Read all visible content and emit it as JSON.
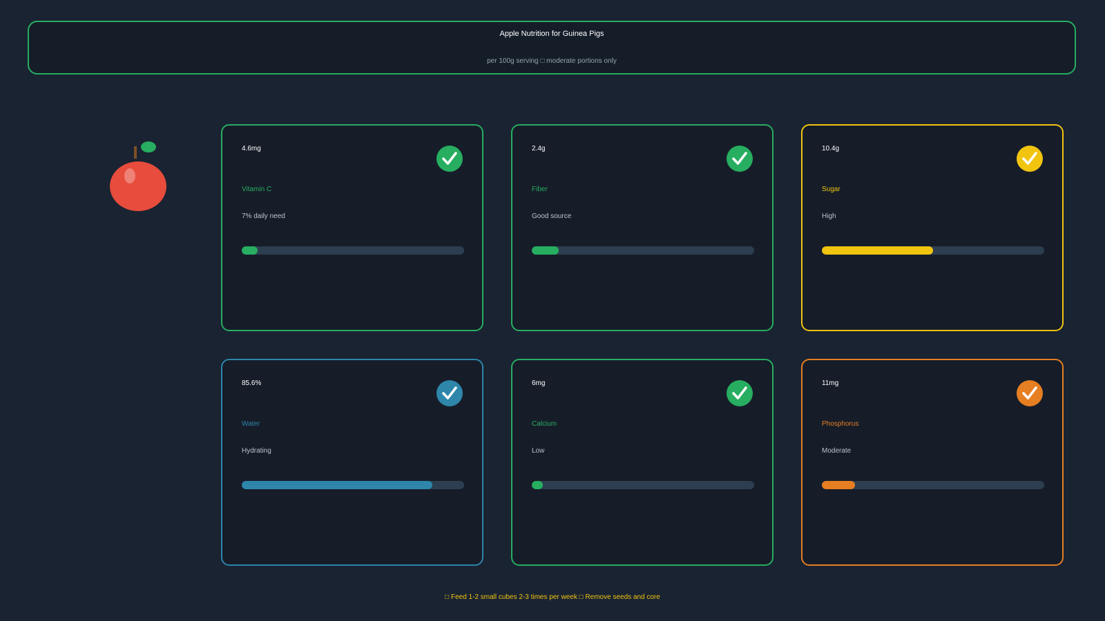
{
  "header": {
    "title": "Apple Nutrition for Guinea Pigs",
    "subtitle": "per 100g serving □ moderate portions only"
  },
  "illustration": {
    "icon": "apple-icon"
  },
  "colors": {
    "background": "#1a2332",
    "good": "#27ae60",
    "caution": "#f1c40f",
    "info": "#2e86ab",
    "warning": "#e67e22",
    "track": "#2c3e50"
  },
  "nutrients": [
    {
      "amount": "4.6mg",
      "name": "Vitamin C",
      "note": "7% daily need",
      "level": 0.07,
      "color": "#27ae60",
      "icon": "check-circle-icon"
    },
    {
      "amount": "2.4g",
      "name": "Fiber",
      "note": "Good source",
      "level": 0.12,
      "color": "#27ae60",
      "icon": "check-circle-icon"
    },
    {
      "amount": "10.4g",
      "name": "Sugar",
      "note": "High",
      "level": 0.5,
      "color": "#f1c40f",
      "icon": "check-circle-icon"
    },
    {
      "amount": "85.6%",
      "name": "Water",
      "note": "Hydrating",
      "level": 0.856,
      "color": "#2e86ab",
      "icon": "check-circle-icon"
    },
    {
      "amount": "6mg",
      "name": "Calcium",
      "note": "Low",
      "level": 0.05,
      "color": "#27ae60",
      "icon": "check-circle-icon"
    },
    {
      "amount": "11mg",
      "name": "Phosphorus",
      "note": "Moderate",
      "level": 0.15,
      "color": "#e67e22",
      "icon": "check-circle-icon"
    }
  ],
  "footer": {
    "text": "□ Feed 1-2 small cubes 2-3 times per week □ Remove seeds and core"
  }
}
